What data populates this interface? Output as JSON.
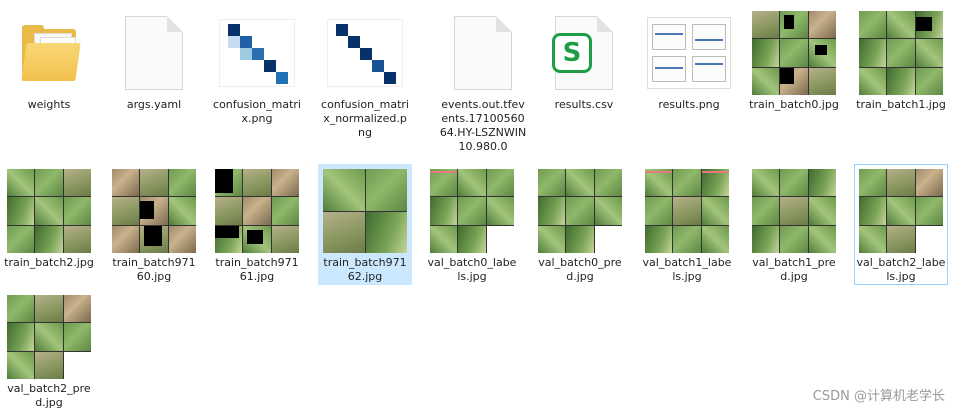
{
  "files": {
    "row1": [
      {
        "name": "weights",
        "type": "folder"
      },
      {
        "name": "args.yaml",
        "type": "document"
      },
      {
        "name": "confusion_matrix.png",
        "type": "image"
      },
      {
        "name": "confusion_matrix_normalized.png",
        "type": "image"
      },
      {
        "name": "events.out.tfevents.1710056064.HY-LSZNWIN10.980.0",
        "type": "document"
      },
      {
        "name": "results.csv",
        "type": "spreadsheet"
      },
      {
        "name": "results.png",
        "type": "image"
      },
      {
        "name": "train_batch0.jpg",
        "type": "image"
      },
      {
        "name": "train_batch1.jpg",
        "type": "image"
      }
    ],
    "row2": [
      {
        "name": "train_batch2.jpg",
        "type": "image"
      },
      {
        "name": "train_batch97160.jpg",
        "type": "image"
      },
      {
        "name": "train_batch97161.jpg",
        "type": "image"
      },
      {
        "name": "train_batch97162.jpg",
        "type": "image",
        "selected": true
      },
      {
        "name": "val_batch0_labels.jpg",
        "type": "image"
      },
      {
        "name": "val_batch0_pred.jpg",
        "type": "image"
      },
      {
        "name": "val_batch1_labels.jpg",
        "type": "image"
      },
      {
        "name": "val_batch1_pred.jpg",
        "type": "image"
      },
      {
        "name": "val_batch2_labels.jpg",
        "type": "image",
        "focused": true
      }
    ],
    "row3": [
      {
        "name": "val_batch2_pred.jpg",
        "type": "image"
      }
    ]
  },
  "csv_badge": "S",
  "colors": {
    "selection": "#cce8ff",
    "focus_border": "#99d1ff",
    "csv_green": "#1e9e47",
    "folder": "#f2c14e"
  },
  "watermark": "CSDN @计算机老学长"
}
